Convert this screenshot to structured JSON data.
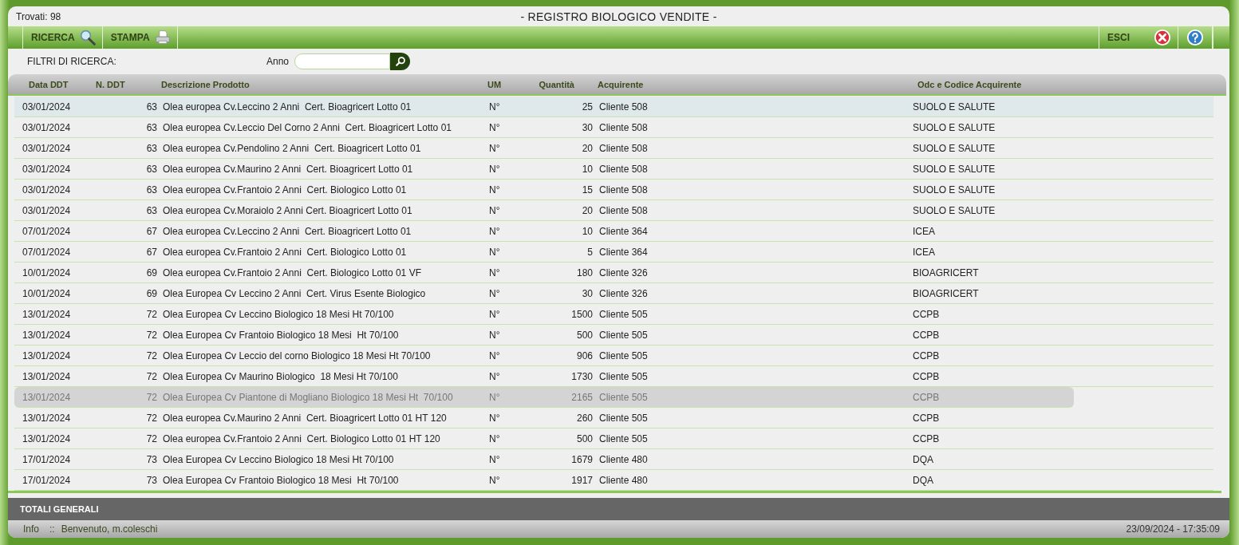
{
  "header": {
    "count": "Trovati: 98",
    "title": "- REGISTRO BIOLOGICO VENDITE -"
  },
  "toolbar": {
    "left": [
      {
        "label": "RICERCA",
        "kind": "search"
      },
      {
        "label": "STAMPA",
        "kind": "print"
      }
    ],
    "exit": {
      "label": "ESCI"
    }
  },
  "filters": {
    "label": "FILTRI DI RICERCA:",
    "fields": [
      {
        "label": "Anno"
      }
    ]
  },
  "table": {
    "columns": [
      "Data DDT",
      "N. DDT",
      "Descrizione Prodotto",
      "UM",
      "Quantità",
      "Acquirente",
      "Odc e Codice Acquirente"
    ],
    "rows": [
      {
        "cells": [
          "03/01/2024",
          "63",
          "Olea europea Cv.Leccino 2 Anni  Cert. Bioagricert Lotto 01",
          "N°",
          "25",
          "Cliente 508",
          "SUOLO E SALUTE"
        ],
        "selected": true,
        "hovered": false
      },
      {
        "cells": [
          "03/01/2024",
          "63",
          "Olea europea Cv.Leccio Del Corno 2 Anni  Cert. Bioagricert Lotto 01",
          "N°",
          "30",
          "Cliente 508",
          "SUOLO E SALUTE"
        ],
        "selected": false,
        "hovered": false
      },
      {
        "cells": [
          "03/01/2024",
          "63",
          "Olea europea Cv.Pendolino 2 Anni  Cert. Bioagricert Lotto 01",
          "N°",
          "20",
          "Cliente 508",
          "SUOLO E SALUTE"
        ],
        "selected": false,
        "hovered": false
      },
      {
        "cells": [
          "03/01/2024",
          "63",
          "Olea europea Cv.Maurino 2 Anni  Cert. Bioagricert Lotto 01",
          "N°",
          "10",
          "Cliente 508",
          "SUOLO E SALUTE"
        ],
        "selected": false,
        "hovered": false
      },
      {
        "cells": [
          "03/01/2024",
          "63",
          "Olea europea Cv.Frantoio 2 Anni  Cert. Biologico Lotto 01",
          "N°",
          "15",
          "Cliente 508",
          "SUOLO E SALUTE"
        ],
        "selected": false,
        "hovered": false
      },
      {
        "cells": [
          "03/01/2024",
          "63",
          "Olea europea Cv.Moraiolo 2 Anni Cert. Bioagricert Lotto 01",
          "N°",
          "20",
          "Cliente 508",
          "SUOLO E SALUTE"
        ],
        "selected": false,
        "hovered": false
      },
      {
        "cells": [
          "07/01/2024",
          "67",
          "Olea europea Cv.Leccino 2 Anni  Cert. Bioagricert Lotto 01",
          "N°",
          "10",
          "Cliente 364",
          "ICEA"
        ],
        "selected": false,
        "hovered": false
      },
      {
        "cells": [
          "07/01/2024",
          "67",
          "Olea europea Cv.Frantoio 2 Anni  Cert. Biologico Lotto 01",
          "N°",
          "5",
          "Cliente 364",
          "ICEA"
        ],
        "selected": false,
        "hovered": false
      },
      {
        "cells": [
          "10/01/2024",
          "69",
          "Olea europea Cv.Frantoio 2 Anni  Cert. Biologico Lotto 01 VF",
          "N°",
          "180",
          "Cliente 326",
          "BIOAGRICERT"
        ],
        "selected": false,
        "hovered": false
      },
      {
        "cells": [
          "10/01/2024",
          "69",
          "Olea Europea Cv Leccino 2 Anni  Cert. Virus Esente Biologico",
          "N°",
          "30",
          "Cliente 326",
          "BIOAGRICERT"
        ],
        "selected": false,
        "hovered": false
      },
      {
        "cells": [
          "13/01/2024",
          "72",
          "Olea Europea Cv Leccino Biologico 18 Mesi Ht 70/100",
          "N°",
          "1500",
          "Cliente 505",
          "CCPB"
        ],
        "selected": false,
        "hovered": false
      },
      {
        "cells": [
          "13/01/2024",
          "72",
          "Olea Europea Cv Frantoio Biologico 18 Mesi  Ht 70/100",
          "N°",
          "500",
          "Cliente 505",
          "CCPB"
        ],
        "selected": false,
        "hovered": false
      },
      {
        "cells": [
          "13/01/2024",
          "72",
          "Olea Europea Cv Leccio del corno Biologico 18 Mesi Ht 70/100",
          "N°",
          "906",
          "Cliente 505",
          "CCPB"
        ],
        "selected": false,
        "hovered": false
      },
      {
        "cells": [
          "13/01/2024",
          "72",
          "Olea Europea Cv Maurino Biologico  18 Mesi Ht 70/100",
          "N°",
          "1730",
          "Cliente 505",
          "CCPB"
        ],
        "selected": false,
        "hovered": false
      },
      {
        "cells": [
          "13/01/2024",
          "72",
          "Olea Europea Cv Piantone di Mogliano Biologico 18 Mesi Ht  70/100",
          "N°",
          "2165",
          "Cliente 505",
          "CCPB"
        ],
        "selected": false,
        "hovered": true
      },
      {
        "cells": [
          "13/01/2024",
          "72",
          "Olea europea Cv.Maurino 2 Anni  Cert. Bioagricert Lotto 01 HT 120",
          "N°",
          "260",
          "Cliente 505",
          "CCPB"
        ],
        "selected": false,
        "hovered": false
      },
      {
        "cells": [
          "13/01/2024",
          "72",
          "Olea europea Cv.Frantoio 2 Anni  Cert. Biologico Lotto 01 HT 120",
          "N°",
          "500",
          "Cliente 505",
          "CCPB"
        ],
        "selected": false,
        "hovered": false
      },
      {
        "cells": [
          "17/01/2024",
          "73",
          "Olea Europea Cv Leccino Biologico 18 Mesi Ht 70/100",
          "N°",
          "1679",
          "Cliente 480",
          "DQA"
        ],
        "selected": false,
        "hovered": false
      },
      {
        "cells": [
          "17/01/2024",
          "73",
          "Olea Europea Cv Frantoio Biologico 18 Mesi  Ht 70/100",
          "N°",
          "1917",
          "Cliente 480",
          "DQA"
        ],
        "selected": false,
        "hovered": false
      }
    ]
  },
  "totals": {
    "label": "TOTALI GENERALI"
  },
  "status_bar": {
    "info": "Info",
    "separator": "::",
    "message": "Benvenuto, m.coleschi",
    "datetime": "23/09/2024 - 17:35:09"
  }
}
